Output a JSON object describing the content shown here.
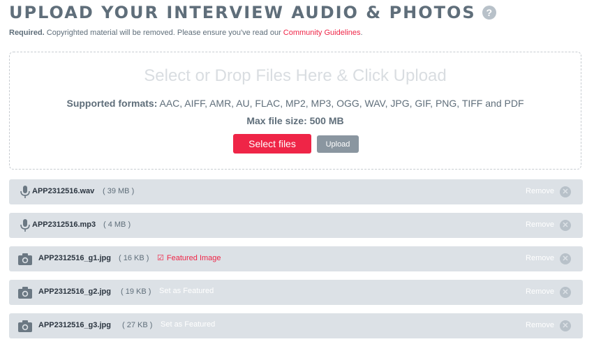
{
  "header": {
    "title": "UPLOAD YOUR INTERVIEW AUDIO & PHOTOS",
    "help_icon": "?"
  },
  "notice": {
    "required": "Required.",
    "text": " Copyrighted material will be removed. Please ensure you've read our ",
    "link": "Community Guidelines",
    "end": "."
  },
  "dropzone": {
    "title": "Select or Drop Files Here & Click Upload",
    "formats_label": "Supported formats:",
    "formats_value": " AAC, AIFF, AMR, AU, FLAC, MP2, MP3, OGG, WAV, JPG, GIF, PNG, TIFF and PDF",
    "max_size": "Max file size: 500 MB",
    "select_label": "Select files",
    "upload_label": "Upload"
  },
  "files": [
    {
      "icon": "microphone-icon",
      "name": "APP2312516.wav",
      "size": "( 39 MB )",
      "remove": "Remove"
    },
    {
      "icon": "microphone-icon",
      "name": "APP2312516.mp3",
      "size": "( 4 MB )",
      "remove": "Remove"
    },
    {
      "icon": "camera-icon",
      "name": "APP2312516_g1.jpg",
      "size": "( 16 KB )",
      "featured": "Featured Image",
      "remove": "Remove"
    },
    {
      "icon": "camera-icon",
      "name": "APP2312516_g2.jpg",
      "size": "( 19 KB )",
      "set_featured": "Set as Featured",
      "remove": "Remove"
    },
    {
      "icon": "camera-icon",
      "name": "APP2312516_g3.jpg",
      "size": "( 27 KB )",
      "set_featured": "Set as Featured",
      "remove": "Remove"
    }
  ],
  "colors": {
    "accent": "#ef2547",
    "text": "#5f6e7a",
    "row_bg": "#dce1e6"
  }
}
